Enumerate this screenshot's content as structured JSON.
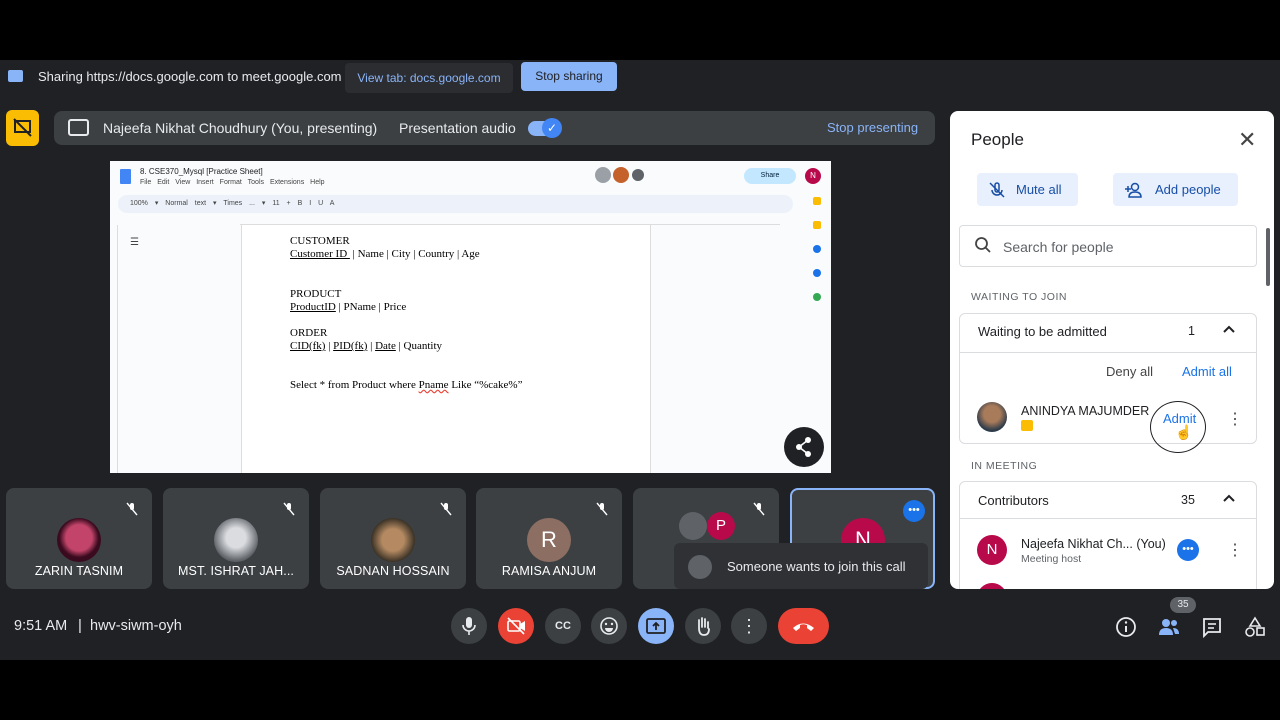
{
  "share_bar": {
    "text": "Sharing https://docs.google.com to meet.google.com",
    "view_tab": "View tab: docs.google.com",
    "stop_sharing": "Stop sharing"
  },
  "presenting_bar": {
    "presenter": "Najeefa Nikhat Choudhury (You, presenting)",
    "audio_label": "Presentation audio",
    "audio_on": true,
    "stop_presenting": "Stop presenting"
  },
  "shared_doc": {
    "title": "8. CSE370_Mysql [Practice Sheet]",
    "menu": "File Edit View Insert Format Tools Extensions Help",
    "share_label": "Share",
    "toolbar": "100%  ▾  Normal text ▾  Times ... ▾  11  +  B  I  U  A",
    "avatar_initial": "N",
    "lines": {
      "customer": "CUSTOMER",
      "customer_id": "Customer ID ",
      "customer_fields": " | Name | City | Country | Age",
      "product": "PRODUCT",
      "product_id": "ProductID",
      "product_fields": " | PName | Price",
      "order": "ORDER",
      "cid": "CID(fk)",
      "pid": "PID(fk)",
      "date": "Date",
      "quantity": " | Quantity",
      "query_prefix": "Select * from Product where ",
      "query_pname": "Pname",
      "query_suffix": " Like “%cake%”"
    }
  },
  "tiles": [
    {
      "name": "ZARIN TASNIM",
      "muted": true
    },
    {
      "name": "MST. ISHRAT JAH...",
      "muted": true
    },
    {
      "name": "SADNAN HOSSAIN",
      "muted": true
    },
    {
      "name": "RAMISA ANJUM",
      "muted": true,
      "initial": "R"
    },
    {
      "name": "",
      "muted": true,
      "initial": "P"
    },
    {
      "name": "",
      "muted": false,
      "initial": "N"
    }
  ],
  "toast": {
    "text": "Someone wants to join this call"
  },
  "bottom_bar": {
    "time": "9:51 AM",
    "separator": "|",
    "meeting_code": "hwv-siwm-oyh",
    "participant_count": "35"
  },
  "people_panel": {
    "title": "People",
    "mute_all": "Mute all",
    "add_people": "Add people",
    "search_placeholder": "Search for people",
    "waiting_section": "WAITING TO JOIN",
    "waiting_header": "Waiting to be admitted",
    "waiting_count": "1",
    "deny_all": "Deny all",
    "admit_all": "Admit all",
    "waiting_person": "ANINDYA MAJUMDER",
    "admit": "Admit",
    "meeting_section": "IN MEETING",
    "contributors_header": "Contributors",
    "contributors_count": "35",
    "host_name": "Najeefa Nikhat Ch...",
    "host_you": "(You)",
    "host_role": "Meeting host",
    "host_initial": "N"
  },
  "colors": {
    "accent_blue": "#8ab4f8",
    "end_call_red": "#ea4335",
    "present_yellow": "#fbbc04",
    "avatar_maroon": "#b80a4b"
  }
}
